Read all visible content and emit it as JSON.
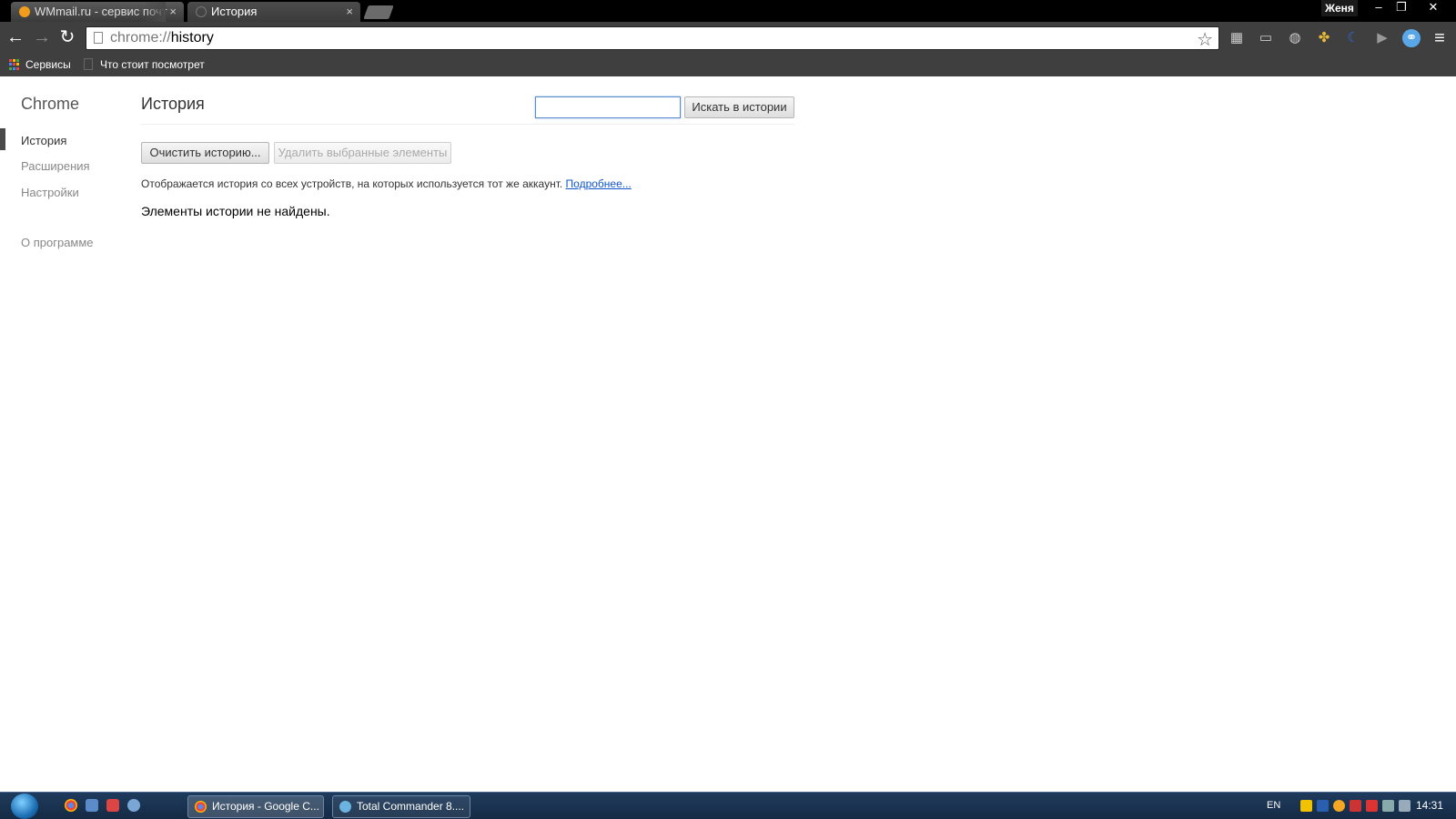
{
  "window": {
    "user": "Женя",
    "minimize": "–",
    "restore": "❐",
    "close": "✕"
  },
  "tabs": [
    {
      "title": "WMmail.ru - сервис почт",
      "close": "×",
      "icon": "wmmail-favicon"
    },
    {
      "title": "История",
      "close": "×",
      "icon": "blank-favicon"
    }
  ],
  "toolbar": {
    "back": "←",
    "forward": "→",
    "reload": "↻",
    "url_scheme": "chrome://",
    "url_path": "history",
    "star": "☆"
  },
  "extensions": [
    {
      "name": "reader-extension-icon",
      "glyph": "▦"
    },
    {
      "name": "card-extension-icon",
      "glyph": "▭"
    },
    {
      "name": "globe-extension-icon",
      "glyph": "◍"
    },
    {
      "name": "colorful-extension-icon",
      "glyph": "✤"
    },
    {
      "name": "crescent-extension-icon",
      "glyph": "☾"
    },
    {
      "name": "play-extension-icon",
      "glyph": "▶"
    },
    {
      "name": "link-extension-icon",
      "glyph": "⚭"
    },
    {
      "name": "menu-icon",
      "glyph": "≡"
    }
  ],
  "bookmarks": [
    {
      "label": "Сервисы",
      "icon": "apps-grid-icon"
    },
    {
      "label": "Что стоит посмотрет",
      "icon": "page-icon"
    }
  ],
  "sidebar": {
    "title": "Chrome",
    "items": [
      {
        "label": "История"
      },
      {
        "label": "Расширения"
      },
      {
        "label": "Настройки"
      }
    ],
    "about": "О программе"
  },
  "main": {
    "title": "История",
    "search_placeholder": "",
    "search_button": "Искать в истории",
    "clear_button": "Очистить историю...",
    "remove_button": "Удалить выбранные элементы",
    "info_text": "Отображается история со всех устройств, на которых используется тот же аккаунт.",
    "info_link": "Подробнее...",
    "empty_text": "Элементы истории не найдены."
  },
  "taskbar": {
    "tasks": [
      {
        "label": "История - Google C..."
      },
      {
        "label": "Total Commander 8...."
      }
    ],
    "language": "EN",
    "time": "14:31"
  },
  "colors": {
    "accent_link": "#1155cc",
    "taskbar": "#1f3b5c"
  }
}
